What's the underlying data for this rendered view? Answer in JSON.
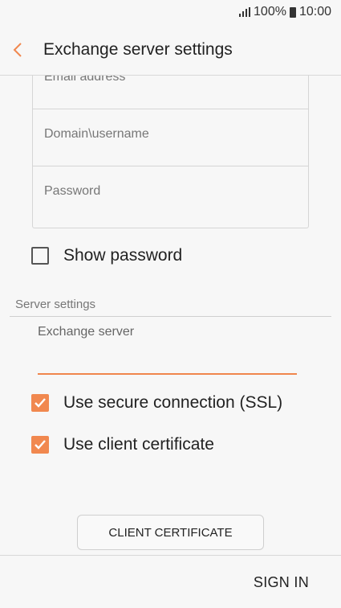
{
  "status_bar": {
    "battery": "100%",
    "time": "10:00",
    "icons": [
      "signal-icon",
      "battery-icon"
    ]
  },
  "app_bar": {
    "title": "Exchange server settings",
    "back_icon": "chevron-left-icon"
  },
  "account_fields": [
    {
      "label": "Email address"
    },
    {
      "label": "Domain\\username"
    },
    {
      "label": "Password"
    }
  ],
  "show_password": {
    "label": "Show password",
    "checked": false
  },
  "server_settings": {
    "header": "Server settings",
    "exchange_server_label": "Exchange server",
    "exchange_server_value": ""
  },
  "options": [
    {
      "label": "Use secure connection (SSL)",
      "checked": true
    },
    {
      "label": "Use client certificate",
      "checked": true
    }
  ],
  "client_certificate_button": "CLIENT CERTIFICATE",
  "sign_in_button": "SIGN IN",
  "colors": {
    "accent": "#f1884f",
    "background": "#f7f7f7"
  }
}
